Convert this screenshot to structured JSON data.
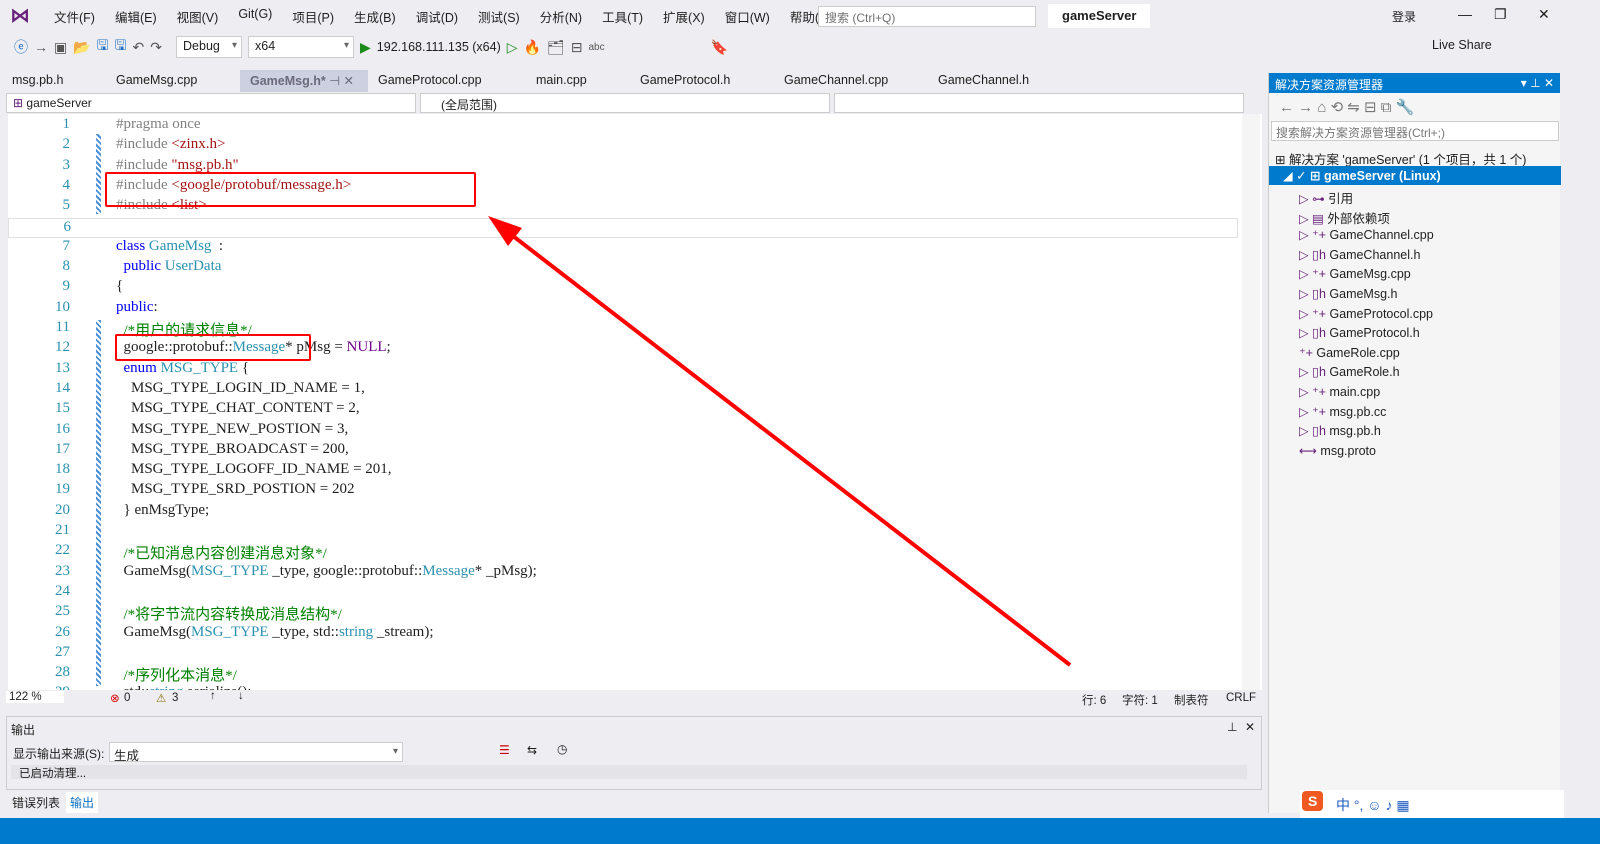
{
  "menubar": {
    "items": [
      "文件(F)",
      "编辑(E)",
      "视图(V)",
      "Git(G)",
      "项目(P)",
      "生成(B)",
      "调试(D)",
      "测试(S)",
      "分析(N)",
      "工具(T)",
      "扩展(X)",
      "窗口(W)",
      "帮助(H)"
    ],
    "search_placeholder": "搜索 (Ctrl+Q)",
    "title": "gameServer",
    "login": "登录"
  },
  "toolbar": {
    "config": "Debug",
    "platform": "x64",
    "run_target": "192.168.111.135 (x64)",
    "live_share": "Live Share"
  },
  "tabs": [
    {
      "label": "msg.pb.h"
    },
    {
      "label": "GameMsg.cpp"
    },
    {
      "label": "GameMsg.h*",
      "active": true
    },
    {
      "label": "GameProtocol.cpp"
    },
    {
      "label": "main.cpp"
    },
    {
      "label": "GameProtocol.h"
    },
    {
      "label": "GameChannel.cpp"
    },
    {
      "label": "GameChannel.h"
    }
  ],
  "navbar": {
    "project": "gameServer",
    "scope": "(全局范围)"
  },
  "code": [
    [
      [
        "pp",
        "#pragma once"
      ]
    ],
    [
      [
        "pp",
        "#include "
      ],
      [
        "str",
        "<zinx.h>"
      ]
    ],
    [
      [
        "pp",
        "#include "
      ],
      [
        "str",
        "\"msg.pb.h\""
      ]
    ],
    [
      [
        "pp",
        "#include "
      ],
      [
        "str",
        "<google/protobuf/message.h>"
      ]
    ],
    [
      [
        "pp",
        "#include "
      ],
      [
        "str",
        "<list>"
      ]
    ],
    [],
    [
      [
        "kw",
        "class "
      ],
      [
        "ty",
        "GameMsg"
      ],
      [
        "",
        "  :"
      ]
    ],
    [
      [
        "kw",
        "  public "
      ],
      [
        "ty",
        "UserData"
      ]
    ],
    [
      [
        "",
        "{"
      ]
    ],
    [
      [
        "kw",
        "public"
      ],
      [
        "",
        ":"
      ]
    ],
    [
      [
        "cm",
        "  /*用户的请求信息*/"
      ]
    ],
    [
      [
        "",
        "  google::protobuf::"
      ],
      [
        "ty",
        "Message"
      ],
      [
        "",
        "* pMsg = "
      ],
      [
        "mac",
        "NULL"
      ],
      [
        "",
        ";"
      ]
    ],
    [
      [
        "kw",
        "  enum "
      ],
      [
        "ty",
        "MSG_TYPE"
      ],
      [
        "",
        " {"
      ]
    ],
    [
      [
        "",
        "    MSG_TYPE_LOGIN_ID_NAME = 1,"
      ]
    ],
    [
      [
        "",
        "    MSG_TYPE_CHAT_CONTENT = 2,"
      ]
    ],
    [
      [
        "",
        "    MSG_TYPE_NEW_POSTION = 3,"
      ]
    ],
    [
      [
        "",
        "    MSG_TYPE_BROADCAST = 200,"
      ]
    ],
    [
      [
        "",
        "    MSG_TYPE_LOGOFF_ID_NAME = 201,"
      ]
    ],
    [
      [
        "",
        "    MSG_TYPE_SRD_POSTION = 202"
      ]
    ],
    [
      [
        "",
        "  } enMsgType;"
      ]
    ],
    [],
    [
      [
        "cm",
        "  /*已知消息内容创建消息对象*/"
      ]
    ],
    [
      [
        "",
        "  GameMsg("
      ],
      [
        "ty",
        "MSG_TYPE"
      ],
      [
        "",
        " _type, google::protobuf::"
      ],
      [
        "ty",
        "Message"
      ],
      [
        "",
        "* _pMsg);"
      ]
    ],
    [],
    [
      [
        "cm",
        "  /*将字节流内容转换成消息结构*/"
      ]
    ],
    [
      [
        "",
        "  GameMsg("
      ],
      [
        "ty",
        "MSG_TYPE"
      ],
      [
        "",
        " _type, std::"
      ],
      [
        "ty",
        "string"
      ],
      [
        "",
        " _stream);"
      ]
    ],
    [],
    [
      [
        "cm",
        "  /*序列化本消息*/"
      ]
    ],
    [
      [
        "",
        "  std::"
      ],
      [
        "ty",
        "string"
      ],
      [
        "",
        " serialize();"
      ]
    ]
  ],
  "editor_status": {
    "zoom": "122 %",
    "errors": "0",
    "warnings": "3",
    "line": "行: 6",
    "char": "字符: 1",
    "tabs": "制表符",
    "eol": "CRLF"
  },
  "output": {
    "title": "输出",
    "source_label": "显示输出来源(S):",
    "source": "生成",
    "text": "已启动清理..."
  },
  "bottom_tabs": [
    "错误列表",
    "输出"
  ],
  "solution": {
    "title": "解决方案资源管理器",
    "search_placeholder": "搜索解决方案资源管理器(Ctrl+;)",
    "root": "解决方案 'gameServer' (1 个项目，共 1 个)",
    "project": "gameServer (Linux)",
    "items": [
      "引用",
      "外部依赖项",
      "GameChannel.cpp",
      "GameChannel.h",
      "GameMsg.cpp",
      "GameMsg.h",
      "GameProtocol.cpp",
      "GameProtocol.h",
      "GameRole.cpp",
      "GameRole.h",
      "main.cpp",
      "msg.pb.cc",
      "msg.pb.h",
      "msg.proto"
    ]
  },
  "colors": {
    "accent": "#007acc",
    "annotation": "#ff0000"
  }
}
